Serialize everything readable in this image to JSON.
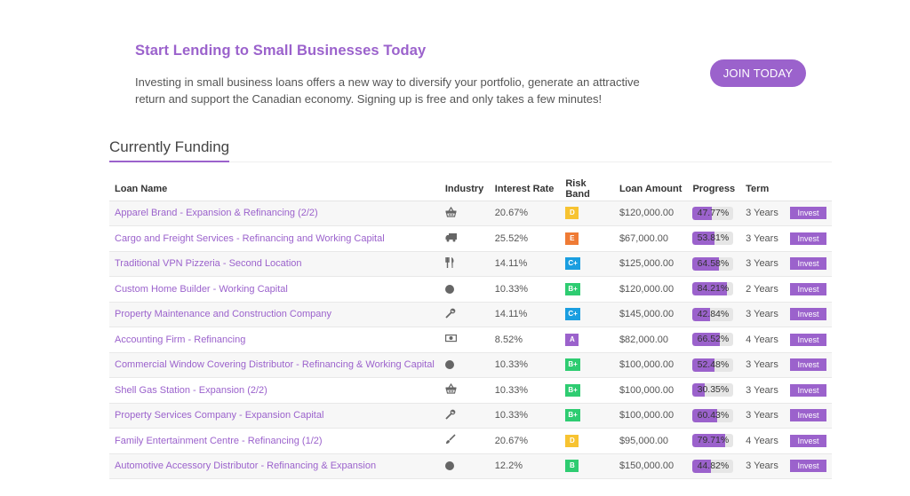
{
  "promo": {
    "title": "Start Lending to Small Businesses Today",
    "text": "Investing in small business loans offers a new way to diversify your portfolio, generate an attractive return and support the Canadian economy. Signing up is free and only takes a few minutes!",
    "join_label": "JOIN TODAY"
  },
  "colors": {
    "accent": "#9b62cc",
    "band_D": "#f7c331",
    "band_E": "#ef7b35",
    "band_Cplus": "#1a9ee0",
    "band_Bplus": "#2ecc71",
    "band_B": "#2ecc71",
    "band_A": "#9b62cc"
  },
  "section": {
    "title": "Currently Funding"
  },
  "table": {
    "headers": [
      "Loan Name",
      "Industry",
      "Interest Rate",
      "Risk Band",
      "Loan Amount",
      "Progress",
      "Term",
      ""
    ],
    "rows": [
      {
        "name": "Apparel Brand - Expansion & Refinancing (2/2)",
        "industry_icon": "basket-icon",
        "rate": "20.67%",
        "band": "D",
        "band_color": "#f7c331",
        "amount": "$120,000.00",
        "progress": 47.77,
        "progress_label": "47.77%",
        "term": "3 Years",
        "action": "Invest"
      },
      {
        "name": "Cargo and Freight Services - Refinancing and Working Capital",
        "industry_icon": "truck-icon",
        "rate": "25.52%",
        "band": "E",
        "band_color": "#ef7b35",
        "amount": "$67,000.00",
        "progress": 53.81,
        "progress_label": "53.81%",
        "term": "3 Years",
        "action": "Invest"
      },
      {
        "name": "Traditional VPN Pizzeria - Second Location",
        "industry_icon": "cutlery-icon",
        "rate": "14.11%",
        "band": "C+",
        "band_color": "#1a9ee0",
        "amount": "$125,000.00",
        "progress": 64.58,
        "progress_label": "64.58%",
        "term": "3 Years",
        "action": "Invest"
      },
      {
        "name": "Custom Home Builder - Working Capital",
        "industry_icon": "circle-icon",
        "rate": "10.33%",
        "band": "B+",
        "band_color": "#2ecc71",
        "amount": "$120,000.00",
        "progress": 84.21,
        "progress_label": "84.21%",
        "term": "2 Years",
        "action": "Invest"
      },
      {
        "name": "Property Maintenance and Construction Company",
        "industry_icon": "wrench-icon",
        "rate": "14.11%",
        "band": "C+",
        "band_color": "#1a9ee0",
        "amount": "$145,000.00",
        "progress": 42.84,
        "progress_label": "42.84%",
        "term": "3 Years",
        "action": "Invest"
      },
      {
        "name": "Accounting Firm - Refinancing",
        "industry_icon": "money-icon",
        "rate": "8.52%",
        "band": "A",
        "band_color": "#9b62cc",
        "amount": "$82,000.00",
        "progress": 66.52,
        "progress_label": "66.52%",
        "term": "4 Years",
        "action": "Invest"
      },
      {
        "name": "Commercial Window Covering Distributor - Refinancing & Working Capital",
        "industry_icon": "circle-icon",
        "rate": "10.33%",
        "band": "B+",
        "band_color": "#2ecc71",
        "amount": "$100,000.00",
        "progress": 52.48,
        "progress_label": "52.48%",
        "term": "3 Years",
        "action": "Invest"
      },
      {
        "name": "Shell Gas Station - Expansion (2/2)",
        "industry_icon": "basket-icon",
        "rate": "10.33%",
        "band": "B+",
        "band_color": "#2ecc71",
        "amount": "$100,000.00",
        "progress": 30.35,
        "progress_label": "30.35%",
        "term": "3 Years",
        "action": "Invest"
      },
      {
        "name": "Property Services Company - Expansion Capital",
        "industry_icon": "wrench-icon",
        "rate": "10.33%",
        "band": "B+",
        "band_color": "#2ecc71",
        "amount": "$100,000.00",
        "progress": 60.43,
        "progress_label": "60.43%",
        "term": "3 Years",
        "action": "Invest"
      },
      {
        "name": "Family Entertainment Centre - Refinancing (1/2)",
        "industry_icon": "brush-icon",
        "rate": "20.67%",
        "band": "D",
        "band_color": "#f7c331",
        "amount": "$95,000.00",
        "progress": 79.71,
        "progress_label": "79.71%",
        "term": "4 Years",
        "action": "Invest"
      },
      {
        "name": "Automotive Accessory Distributor - Refinancing & Expansion",
        "industry_icon": "circle-icon",
        "rate": "12.2%",
        "band": "B",
        "band_color": "#2ecc71",
        "amount": "$150,000.00",
        "progress": 44.82,
        "progress_label": "44.82%",
        "term": "3 Years",
        "action": "Invest"
      }
    ]
  }
}
